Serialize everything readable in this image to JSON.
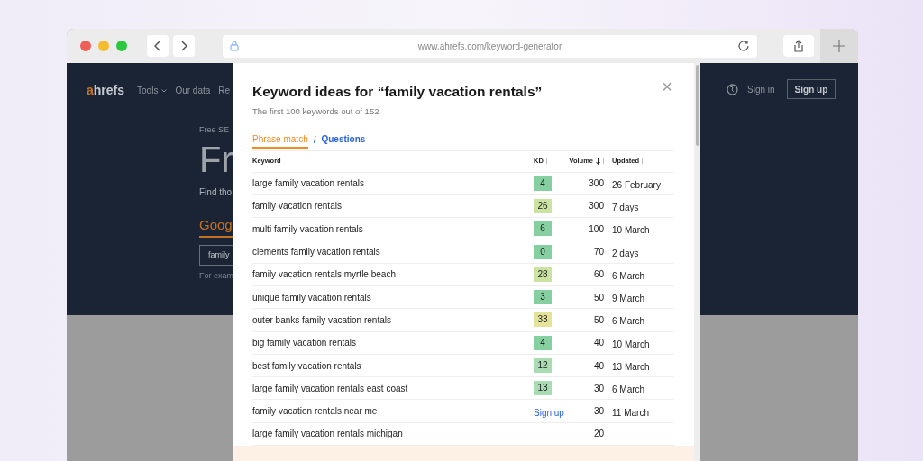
{
  "browser": {
    "url": "www.ahrefs.com/keyword-generator"
  },
  "site": {
    "logo_accent": "a",
    "logo_rest": "hrefs",
    "nav": [
      "Tools",
      "Our data",
      "Re"
    ],
    "sign_in": "Sign in",
    "sign_up": "Sign up",
    "eyebrow": "Free SE",
    "heading": "Fr",
    "intro": "Find tho",
    "engine_tab": "Goog",
    "search_value": "family",
    "example": "For exam"
  },
  "modal": {
    "title": "Keyword ideas for “family vacation rentals”",
    "subtitle": "The first 100 keywords out of 152",
    "close": "×",
    "tabs": [
      {
        "label": "Phrase match",
        "selected": true
      },
      {
        "label": "Questions",
        "selected": false
      }
    ],
    "tab_separator": "/",
    "table": {
      "columns": [
        "Keyword",
        "KD",
        "Volume",
        "Updated"
      ],
      "rows": [
        {
          "keyword": "large family vacation rentals",
          "kd": "4",
          "color": "#86cfa0",
          "volume": "300",
          "updated": "26 February"
        },
        {
          "keyword": "family vacation rentals",
          "kd": "26",
          "color": "#cbe3a2",
          "volume": "300",
          "updated": "7 days"
        },
        {
          "keyword": "multi family vacation rentals",
          "kd": "6",
          "color": "#86cfa0",
          "volume": "100",
          "updated": "10 March"
        },
        {
          "keyword": "clements family vacation rentals",
          "kd": "0",
          "color": "#86cfa0",
          "volume": "70",
          "updated": "2 days"
        },
        {
          "keyword": "family vacation rentals myrtle beach",
          "kd": "28",
          "color": "#cbe3a2",
          "volume": "60",
          "updated": "6 March"
        },
        {
          "keyword": "unique family vacation rentals",
          "kd": "3",
          "color": "#86cfa0",
          "volume": "50",
          "updated": "9 March"
        },
        {
          "keyword": "outer banks family vacation rentals",
          "kd": "33",
          "color": "#e3e49a",
          "volume": "50",
          "updated": "6 March"
        },
        {
          "keyword": "big family vacation rentals",
          "kd": "4",
          "color": "#86cfa0",
          "volume": "40",
          "updated": "10 March"
        },
        {
          "keyword": "best family vacation rentals",
          "kd": "12",
          "color": "#a9dcb2",
          "volume": "40",
          "updated": "13 March"
        },
        {
          "keyword": "large family vacation rentals east coast",
          "kd": "13",
          "color": "#a9dcb2",
          "volume": "30",
          "updated": "6 March"
        },
        {
          "keyword": "family vacation rentals near me",
          "kd_link": "Sign up",
          "volume": "30",
          "updated": "11 March"
        },
        {
          "keyword": "large family vacation rentals michigan",
          "volume": "20"
        }
      ]
    }
  }
}
